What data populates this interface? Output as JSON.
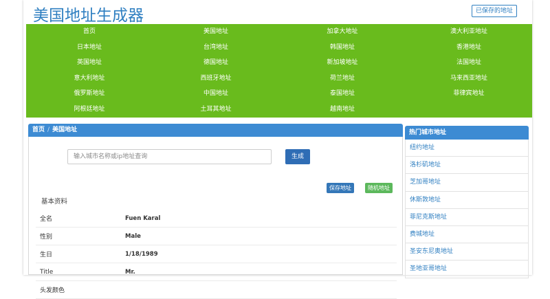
{
  "header": {
    "title": "美国地址生成器",
    "saved_link": "已保存的地址"
  },
  "nav": [
    "首页",
    "美国地址",
    "加拿大地址",
    "澳大利亚地址",
    "日本地址",
    "台湾地址",
    "韩国地址",
    "香港地址",
    "英国地址",
    "德国地址",
    "新加坡地址",
    "法国地址",
    "意大利地址",
    "西班牙地址",
    "荷兰地址",
    "马来西亚地址",
    "俄罗斯地址",
    "中国地址",
    "泰国地址",
    "菲律宾地址",
    "阿根廷地址",
    "土耳其地址",
    "越南地址"
  ],
  "breadcrumb": {
    "home": "首页",
    "separator": "/",
    "current": "美国地址"
  },
  "search": {
    "placeholder": "输入城市名称或ip地址查询",
    "button": "生成"
  },
  "actions": {
    "save": "保存地址",
    "random": "随机地址"
  },
  "profile": {
    "section_title": "基本资料",
    "rows": [
      {
        "label": "全名",
        "value": "Fuen Karal"
      },
      {
        "label": "性别",
        "value": "Male"
      },
      {
        "label": "生日",
        "value": "1/18/1989"
      },
      {
        "label": "Title",
        "value": "Mr."
      },
      {
        "label": "头发颜色",
        "value": ""
      }
    ]
  },
  "sidebar": {
    "title": "热门城市地址",
    "cities": [
      "纽约地址",
      "洛杉矶地址",
      "芝加哥地址",
      "休斯敦地址",
      "菲尼克斯地址",
      "费城地址",
      "圣安东尼奥地址",
      "圣地亚哥地址"
    ]
  },
  "colors": {
    "nav_bg": "#69bb1d",
    "accent": "#3d8bd3",
    "link": "#2f7fc1",
    "random_btn": "#5cb85c"
  }
}
